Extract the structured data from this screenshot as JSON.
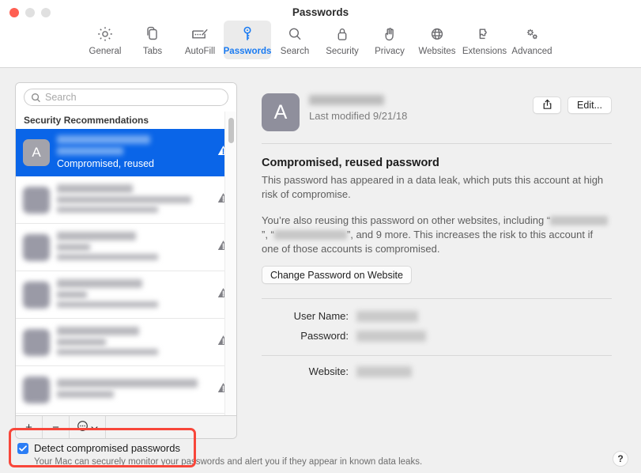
{
  "window": {
    "title": "Passwords",
    "traffic_lights": [
      "close",
      "minimize",
      "maximize"
    ]
  },
  "toolbar": {
    "tabs": [
      {
        "label": "General",
        "icon": "gear-icon",
        "active": false
      },
      {
        "label": "Tabs",
        "icon": "tabs-icon",
        "active": false
      },
      {
        "label": "AutoFill",
        "icon": "autofill-icon",
        "active": false
      },
      {
        "label": "Passwords",
        "icon": "key-icon",
        "active": true
      },
      {
        "label": "Search",
        "icon": "search-icon",
        "active": false
      },
      {
        "label": "Security",
        "icon": "lock-icon",
        "active": false
      },
      {
        "label": "Privacy",
        "icon": "hand-icon",
        "active": false
      },
      {
        "label": "Websites",
        "icon": "globe-icon",
        "active": false
      },
      {
        "label": "Extensions",
        "icon": "puzzle-icon",
        "active": false
      },
      {
        "label": "Advanced",
        "icon": "gears-icon",
        "active": false
      }
    ],
    "active_accent": "#1a7bf2"
  },
  "sidebar": {
    "search": {
      "placeholder": "Search",
      "value": "",
      "icon": "search-icon"
    },
    "group_header": "Security Recommendations",
    "rows": [
      {
        "avatar_letter": "A",
        "site_redacted": true,
        "user_redacted": true,
        "status": "Compromised, reused",
        "warning": true,
        "selected": true
      },
      {
        "avatar_letter": "",
        "site_redacted": true,
        "user_redacted": true,
        "status": "",
        "warning": true,
        "selected": false
      },
      {
        "avatar_letter": "",
        "site_redacted": true,
        "user_redacted": true,
        "status": "",
        "warning": true,
        "selected": false
      },
      {
        "avatar_letter": "",
        "site_redacted": true,
        "user_redacted": true,
        "status": "",
        "warning": true,
        "selected": false
      },
      {
        "avatar_letter": "",
        "site_redacted": true,
        "user_redacted": true,
        "status": "",
        "warning": true,
        "selected": false
      },
      {
        "avatar_letter": "",
        "site_redacted": true,
        "user_redacted": true,
        "status": "",
        "warning": true,
        "selected": false
      }
    ],
    "toolbar": {
      "add_label": "+",
      "remove_label": "−",
      "action_icon": "more-actions-icon",
      "action_chevron": "chevron-down-icon"
    },
    "selection_color": "#0a65e8"
  },
  "detail": {
    "avatar_letter": "A",
    "site_redacted": true,
    "last_modified": "Last modified 9/21/18",
    "share_icon": "share-icon",
    "edit_label": "Edit...",
    "issue_title": "Compromised, reused password",
    "issue_paragraph_1": "This password has appeared in a data leak, which puts this account at high risk of compromise.",
    "issue_paragraph_2_start": "You’re also reusing this password on other websites, including “",
    "issue_paragraph_2_mid": "”, “",
    "issue_paragraph_2_end": "”, and 9 more. This increases the risk to this account if one of those accounts is compromised.",
    "change_password_label": "Change Password on Website",
    "fields": [
      {
        "label": "User Name:",
        "value_redacted": true
      },
      {
        "label": "Password:",
        "value_redacted": true
      },
      {
        "label": "Website:",
        "value_redacted": true
      }
    ]
  },
  "bottom": {
    "detect_checked": true,
    "detect_label": "Detect compromised passwords",
    "detect_sublabel": "Your Mac can securely monitor your passwords and alert you if they appear in known data leaks.",
    "help_label": "?",
    "annotation_color": "#f8463a"
  }
}
